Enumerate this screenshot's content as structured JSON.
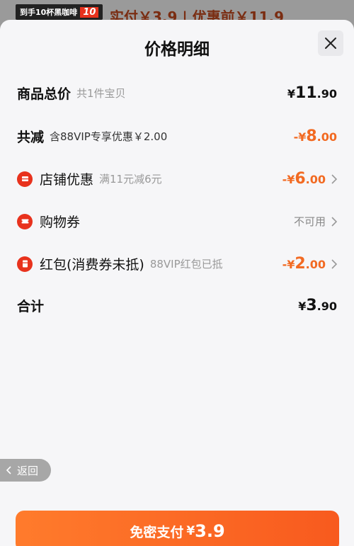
{
  "background": {
    "banner_text": "到手10杯黑咖啡",
    "banner_tag": "10",
    "price_text": "实付￥3.9 | 优惠前￥11.9"
  },
  "sheet": {
    "title": "价格明细",
    "close_icon": "close-icon",
    "rows": {
      "total": {
        "label": "商品总价",
        "sub": "共1件宝贝",
        "currency": "¥",
        "int": "11",
        "dec": ".90"
      },
      "reduce": {
        "label": "共减",
        "sub": "含88VIP专享优惠￥2.00",
        "currency": "-¥",
        "int": "8",
        "dec": ".00"
      },
      "store": {
        "label": "店铺优惠",
        "sub": "满11元减6元",
        "currency": "-¥",
        "int": "6",
        "dec": ".00",
        "icon": "store-coupon-icon"
      },
      "shopping": {
        "label": "购物券",
        "status": "不可用",
        "icon": "ticket-icon"
      },
      "redpacket": {
        "label": "红包(消费券未抵)",
        "sub": "88VIP红包已抵",
        "currency": "-¥",
        "int": "2",
        "dec": ".00",
        "icon": "red-packet-icon"
      },
      "sum": {
        "label": "合计",
        "currency": "¥",
        "int": "3",
        "dec": ".90"
      }
    },
    "back_label": "返回",
    "pay": {
      "label": "免密支付",
      "currency": "¥",
      "value": "3.9"
    }
  },
  "colors": {
    "accent": "#f26a22",
    "icon_red": "#e8321d",
    "sheet_bg": "#f6f6f8"
  }
}
